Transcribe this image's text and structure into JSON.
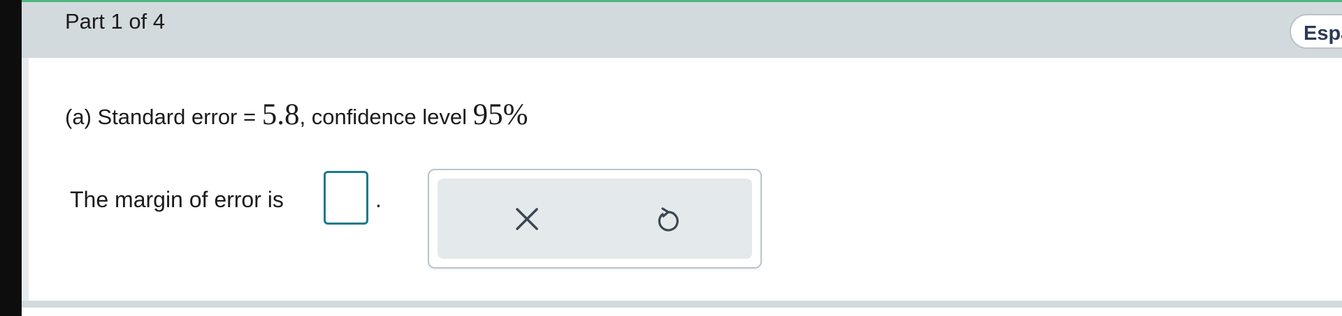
{
  "header": {
    "part_label": "Part 1 of 4",
    "language_button": "Español"
  },
  "question": {
    "prefix": "(a) Standard error",
    "equals": " = ",
    "standard_error": "5.8",
    "middle": ", confidence level ",
    "confidence_level": "95%"
  },
  "answer": {
    "prompt": "The margin of error is",
    "input_value": "",
    "period": "."
  },
  "toolbar": {
    "clear_icon": "x-icon",
    "undo_icon": "undo-icon"
  },
  "colors": {
    "header_bg": "#d3dadd",
    "accent_green": "#4fb87f",
    "input_border": "#1a7a8a",
    "button_text": "#2b3a55"
  }
}
